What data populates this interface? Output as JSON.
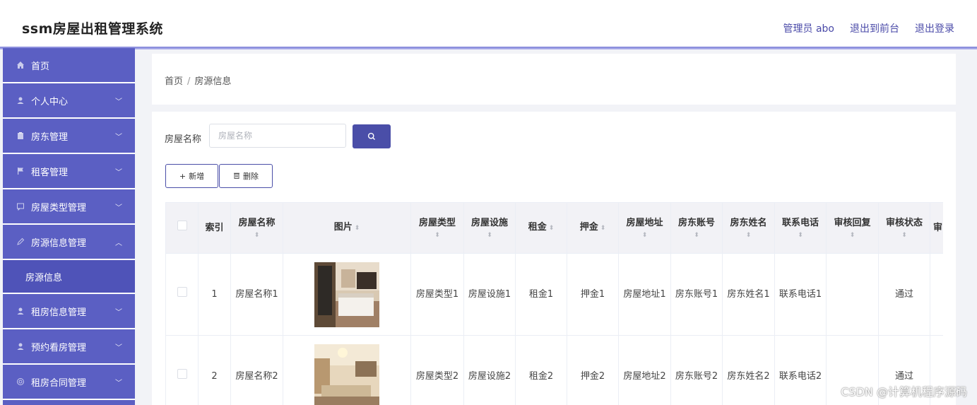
{
  "header": {
    "app_title": "ssm房屋出租管理系统",
    "admin_label": "管理员 abo",
    "front_link": "退出到前台",
    "logout_link": "退出登录"
  },
  "sidebar": {
    "items": [
      {
        "label": "首页",
        "icon": "home-icon",
        "has_chevron": false
      },
      {
        "label": "个人中心",
        "icon": "user-icon",
        "has_chevron": true
      },
      {
        "label": "房东管理",
        "icon": "clipboard-icon",
        "has_chevron": true
      },
      {
        "label": "租客管理",
        "icon": "flag-icon",
        "has_chevron": true
      },
      {
        "label": "房屋类型管理",
        "icon": "chat-icon",
        "has_chevron": true
      },
      {
        "label": "房源信息管理",
        "icon": "pen-icon",
        "has_chevron": true,
        "expanded": true
      },
      {
        "label": "房源信息",
        "submenu": true
      },
      {
        "label": "租房信息管理",
        "icon": "user-icon",
        "has_chevron": true
      },
      {
        "label": "预约看房管理",
        "icon": "user-icon",
        "has_chevron": true
      },
      {
        "label": "租房合同管理",
        "icon": "clock-icon",
        "has_chevron": true
      }
    ]
  },
  "breadcrumb": {
    "home": "首页",
    "separator": "/",
    "current": "房源信息"
  },
  "search": {
    "label": "房屋名称",
    "placeholder": "房屋名称",
    "icon": "search-icon"
  },
  "actions": {
    "add_label": "新增",
    "delete_label": "删除"
  },
  "table": {
    "headers": [
      "索引",
      "房屋名称",
      "图片",
      "房屋类型",
      "房屋设施",
      "租金",
      "押金",
      "房屋地址",
      "房东账号",
      "房东姓名",
      "联系电话",
      "审核回复",
      "审核状态",
      "审"
    ],
    "rows": [
      {
        "index": "1",
        "name": "房屋名称1",
        "type": "房屋类型1",
        "facility": "房屋设施1",
        "rent": "租金1",
        "deposit": "押金1",
        "address": "房屋地址1",
        "account": "房东账号1",
        "landlord": "房东姓名1",
        "phone": "联系电话1",
        "reply": "",
        "status": "通过"
      },
      {
        "index": "2",
        "name": "房屋名称2",
        "type": "房屋类型2",
        "facility": "房屋设施2",
        "rent": "租金2",
        "deposit": "押金2",
        "address": "房屋地址2",
        "account": "房东账号2",
        "landlord": "房东姓名2",
        "phone": "联系电话2",
        "reply": "",
        "status": "通过"
      }
    ]
  },
  "watermark": "CSDN @计算机程序源码",
  "colors": {
    "sidebar": "#5b5fc3",
    "accent": "#4a4ea8",
    "header_bg": "#f2f2f6"
  }
}
